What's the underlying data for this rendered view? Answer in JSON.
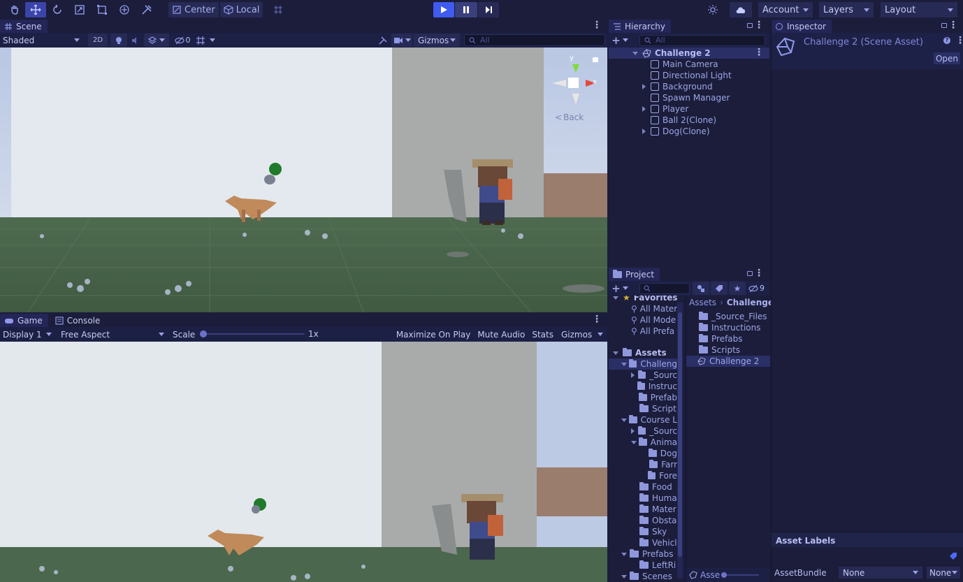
{
  "toolbar": {
    "pivot_label": "Center",
    "space_label": "Local",
    "account_label": "Account",
    "layers_label": "Layers",
    "layout_label": "Layout"
  },
  "scene": {
    "tab_label": "Scene",
    "shading_mode": "Shaded",
    "mode_2d": "2D",
    "hidden_count": "0",
    "gizmos_label": "Gizmos",
    "search_placeholder": "All",
    "back_label": "Back",
    "gizmo_axes": {
      "y": "y",
      "x": "x"
    }
  },
  "game": {
    "tab_label": "Game",
    "console_tab_label": "Console",
    "display_label": "Display 1",
    "aspect_label": "Free Aspect",
    "scale_label": "Scale",
    "scale_value": "1x",
    "scale_fraction": 0.0,
    "maximize_label": "Maximize On Play",
    "mute_label": "Mute Audio",
    "stats_label": "Stats",
    "gizmos_label": "Gizmos"
  },
  "hierarchy": {
    "tab_label": "Hierarchy",
    "search_placeholder": "All",
    "scene_name": "Challenge 2",
    "items": [
      {
        "label": "Main Camera",
        "expandable": false
      },
      {
        "label": "Directional Light",
        "expandable": false
      },
      {
        "label": "Background",
        "expandable": true
      },
      {
        "label": "Spawn Manager",
        "expandable": false
      },
      {
        "label": "Player",
        "expandable": true
      },
      {
        "label": "Ball 2(Clone)",
        "expandable": false
      },
      {
        "label": "Dog(Clone)",
        "expandable": true
      }
    ]
  },
  "inspector": {
    "tab_label": "Inspector",
    "asset_title": "Challenge 2 (Scene Asset)",
    "open_label": "Open",
    "asset_labels_title": "Asset Labels",
    "assetbundle_label": "AssetBundle",
    "assetbundle_value": "None",
    "variant_value": "None"
  },
  "project": {
    "tab_label": "Project",
    "hidden_count": "9",
    "favorites_label": "Favorites",
    "favorites": [
      "All Mater",
      "All Mode",
      "All Prefa"
    ],
    "assets_label": "Assets",
    "tree": [
      {
        "label": "Challeng",
        "depth": 1,
        "state": "open",
        "selected": true
      },
      {
        "label": "_Sourc",
        "depth": 2,
        "state": "closed"
      },
      {
        "label": "Instruc",
        "depth": 2,
        "state": "none"
      },
      {
        "label": "Prefab",
        "depth": 2,
        "state": "none"
      },
      {
        "label": "Script",
        "depth": 2,
        "state": "none"
      },
      {
        "label": "Course L",
        "depth": 1,
        "state": "open"
      },
      {
        "label": "_Sourc",
        "depth": 2,
        "state": "closed"
      },
      {
        "label": "Anima",
        "depth": 2,
        "state": "open"
      },
      {
        "label": "Dog",
        "depth": 3,
        "state": "none"
      },
      {
        "label": "Farr",
        "depth": 3,
        "state": "none"
      },
      {
        "label": "Fore",
        "depth": 3,
        "state": "none"
      },
      {
        "label": "Food",
        "depth": 2,
        "state": "none"
      },
      {
        "label": "Huma",
        "depth": 2,
        "state": "none"
      },
      {
        "label": "Mater",
        "depth": 2,
        "state": "none"
      },
      {
        "label": "Obsta",
        "depth": 2,
        "state": "none"
      },
      {
        "label": "Sky",
        "depth": 2,
        "state": "none"
      },
      {
        "label": "Vehicl",
        "depth": 2,
        "state": "none"
      },
      {
        "label": "Prefabs",
        "depth": 1,
        "state": "open"
      },
      {
        "label": "LeftRi",
        "depth": 2,
        "state": "none"
      },
      {
        "label": "Scenes",
        "depth": 1,
        "state": "open"
      }
    ],
    "breadcrumb": [
      "Assets",
      "Challenge"
    ],
    "contents": [
      {
        "label": "_Source_Files",
        "kind": "folder"
      },
      {
        "label": "Instructions",
        "kind": "folder"
      },
      {
        "label": "Prefabs",
        "kind": "folder"
      },
      {
        "label": "Scripts",
        "kind": "folder"
      },
      {
        "label": "Challenge 2",
        "kind": "scene"
      }
    ],
    "footer_label": "Asse"
  },
  "colors": {
    "accent": "#4d5bd6",
    "panel_bg": "#1b1d3a",
    "text": "#b9bfea"
  }
}
